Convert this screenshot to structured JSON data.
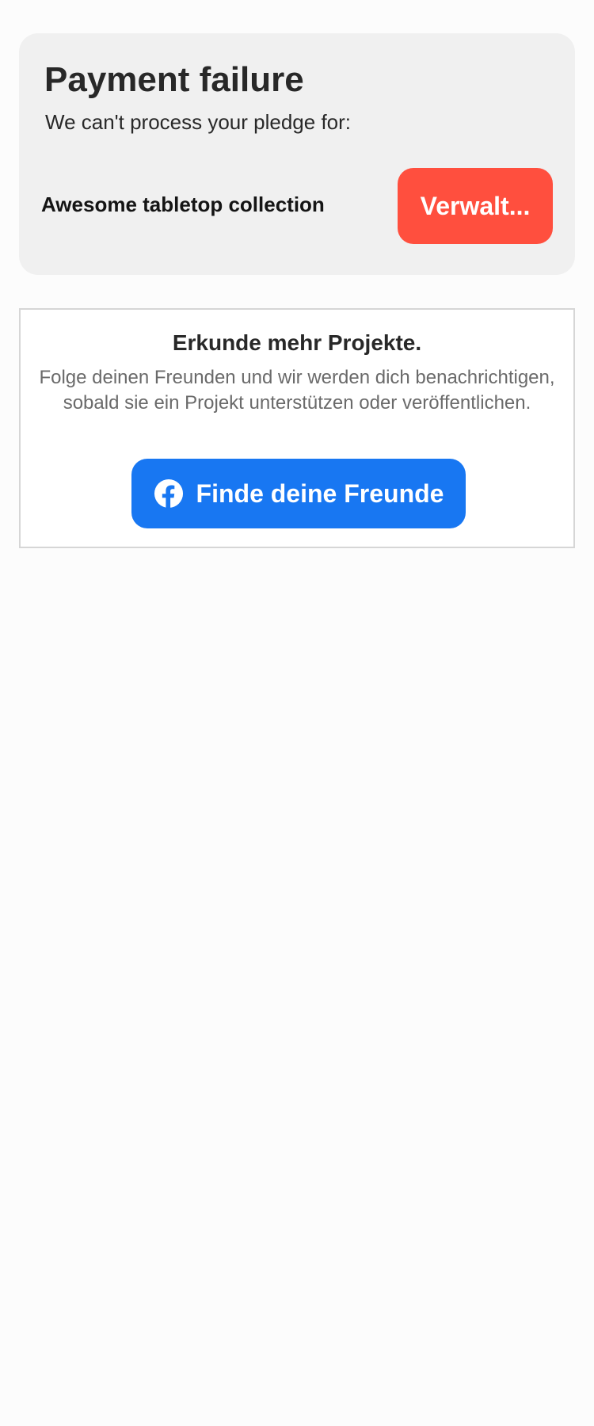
{
  "payment_failure": {
    "title": "Payment failure",
    "subtitle": "We can't process your pledge for:",
    "project_name": "Awesome tabletop collection",
    "manage_button_label": "Verwalt..."
  },
  "explore": {
    "heading": "Erkunde mehr Projekte.",
    "description": "Folge deinen Freunden und wir werden dich benachrichtigen, sobald sie ein Projekt unterstützen oder veröffentlichen.",
    "find_friends_label": "Finde deine Freunde",
    "find_friends_icon": "facebook-icon"
  },
  "colors": {
    "card_background": "#f0f0f0",
    "manage_button": "#ff4f3e",
    "facebook_blue": "#1877f2",
    "text_primary": "#282828",
    "text_secondary": "#6a6a6a"
  }
}
